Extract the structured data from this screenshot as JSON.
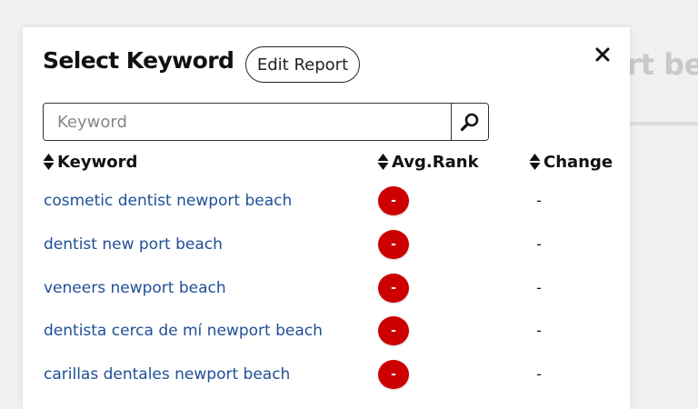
{
  "background": {
    "title_fragment": "ort be"
  },
  "modal": {
    "title": "Select Keyword",
    "edit_report_label": "Edit Report",
    "close_label": "✕",
    "search": {
      "placeholder": "Keyword",
      "value": "",
      "icon": "search-icon"
    },
    "columns": {
      "keyword": "Keyword",
      "avg_rank": "Avg.Rank",
      "change": "Change"
    },
    "rows": [
      {
        "keyword": "cosmetic dentist newport beach",
        "avg_rank": "-",
        "change": "-"
      },
      {
        "keyword": "dentist new port beach",
        "avg_rank": "-",
        "change": "-"
      },
      {
        "keyword": "veneers newport beach",
        "avg_rank": "-",
        "change": "-"
      },
      {
        "keyword": "dentista cerca de mí newport beach",
        "avg_rank": "-",
        "change": "-"
      },
      {
        "keyword": "carillas dentales newport beach",
        "avg_rank": "-",
        "change": "-"
      }
    ]
  },
  "colors": {
    "link": "#1f4f96",
    "rank_badge": "#cc0000",
    "overlay_background": "#f0f0f0"
  }
}
